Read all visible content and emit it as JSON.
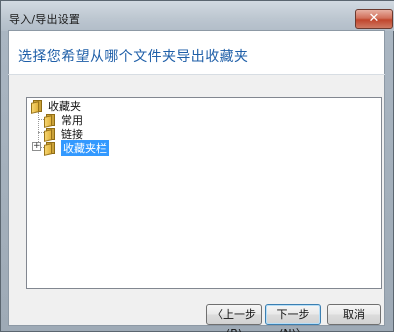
{
  "window": {
    "title": "导入/导出设置",
    "close_glyph": "✕"
  },
  "heading": "选择您希望从哪个文件夹导出收藏夹",
  "tree": {
    "root": "收藏夹",
    "children": [
      "常用",
      "链接",
      "收藏夹栏"
    ],
    "selected": "收藏夹栏",
    "expander_glyph": "+"
  },
  "buttons": {
    "back": "〈上一步(B)",
    "next": "下一步(N)〉",
    "cancel": "取消"
  },
  "icons": {
    "folder": "folder-icon",
    "expand": "plus-icon",
    "close": "close-icon"
  }
}
